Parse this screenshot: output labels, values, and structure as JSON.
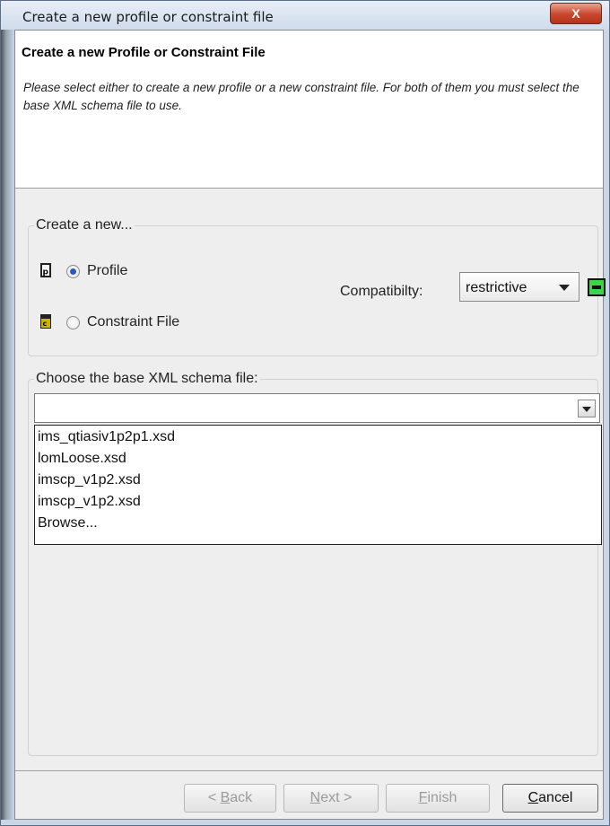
{
  "window": {
    "title": "Create a new profile or constraint file",
    "close_label": "X"
  },
  "header": {
    "title": "Create a new Profile or Constraint File",
    "description": "Please select either to create a new profile or a new constraint file. For both of them you must select the base XML schema file to use."
  },
  "create_group": {
    "title": "Create a new...",
    "profile_label": "Profile",
    "profile_selected": true,
    "constraint_label": "Constraint File",
    "constraint_selected": false,
    "compat_label": "Compatibilty:",
    "compat_value": "restrictive"
  },
  "schema_group": {
    "title": "Choose the base XML schema file:",
    "input_value": "",
    "options": [
      "ims_qtiasiv1p2p1.xsd",
      "lomLoose.xsd",
      "imscp_v1p2.xsd",
      "imscp_v1p2.xsd",
      "Browse..."
    ]
  },
  "buttons": {
    "back": {
      "pre": "< ",
      "mnemonic": "B",
      "post": "ack"
    },
    "next": {
      "mnemonic": "N",
      "post": "ext >"
    },
    "finish": {
      "mnemonic": "F",
      "post": "inish"
    },
    "cancel": {
      "mnemonic": "C",
      "post": "ancel"
    }
  },
  "colors": {
    "status_green": "#3bd44b",
    "radio_selected": "#2a5bbb"
  }
}
